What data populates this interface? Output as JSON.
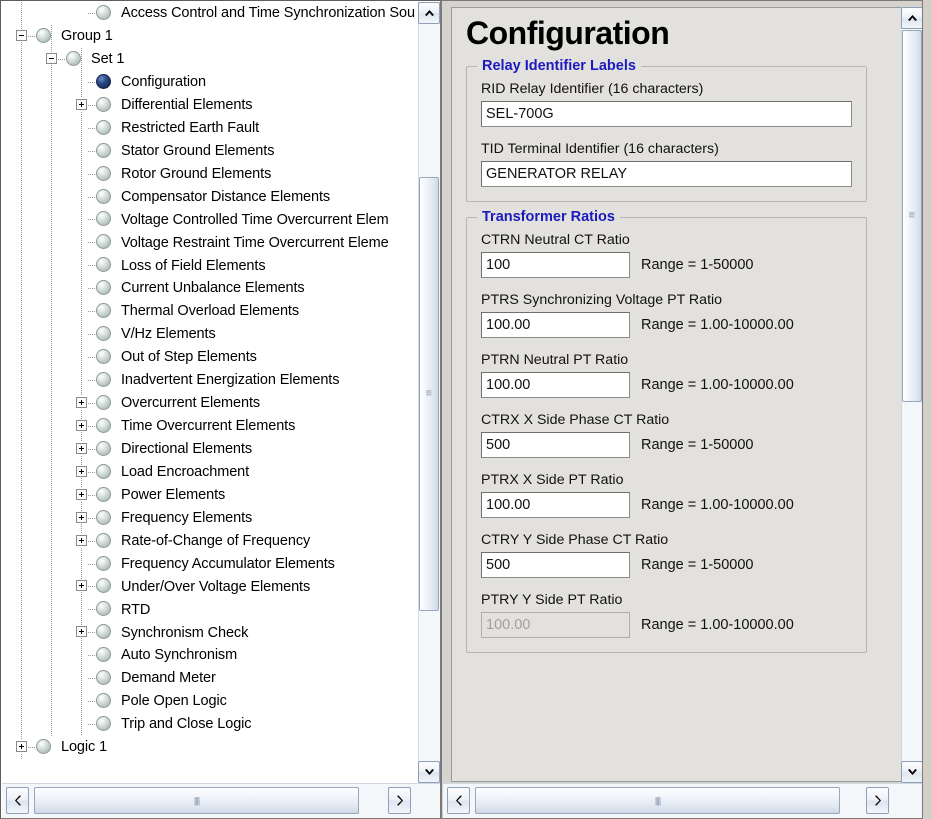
{
  "tree": {
    "nodes": [
      {
        "label": "Access Control and Time Synchronization Sou",
        "depth": 3,
        "expander": "none",
        "selected": false
      },
      {
        "label": "Group 1",
        "depth": 1,
        "expander": "minus",
        "selected": false
      },
      {
        "label": "Set 1",
        "depth": 2,
        "expander": "minus",
        "selected": false
      },
      {
        "label": "Configuration",
        "depth": 3,
        "expander": "none",
        "selected": true
      },
      {
        "label": "Differential Elements",
        "depth": 3,
        "expander": "plus",
        "selected": false
      },
      {
        "label": "Restricted Earth Fault",
        "depth": 3,
        "expander": "none",
        "selected": false
      },
      {
        "label": "Stator Ground Elements",
        "depth": 3,
        "expander": "none",
        "selected": false
      },
      {
        "label": "Rotor Ground Elements",
        "depth": 3,
        "expander": "none",
        "selected": false
      },
      {
        "label": "Compensator Distance Elements",
        "depth": 3,
        "expander": "none",
        "selected": false
      },
      {
        "label": "Voltage Controlled Time Overcurrent Elem",
        "depth": 3,
        "expander": "none",
        "selected": false
      },
      {
        "label": "Voltage Restraint Time Overcurrent Eleme",
        "depth": 3,
        "expander": "none",
        "selected": false
      },
      {
        "label": "Loss of Field Elements",
        "depth": 3,
        "expander": "none",
        "selected": false
      },
      {
        "label": "Current Unbalance Elements",
        "depth": 3,
        "expander": "none",
        "selected": false
      },
      {
        "label": "Thermal Overload  Elements",
        "depth": 3,
        "expander": "none",
        "selected": false
      },
      {
        "label": "V/Hz Elements",
        "depth": 3,
        "expander": "none",
        "selected": false
      },
      {
        "label": "Out of Step Elements",
        "depth": 3,
        "expander": "none",
        "selected": false
      },
      {
        "label": "Inadvertent Energization Elements",
        "depth": 3,
        "expander": "none",
        "selected": false
      },
      {
        "label": "Overcurrent Elements",
        "depth": 3,
        "expander": "plus",
        "selected": false
      },
      {
        "label": "Time Overcurrent Elements",
        "depth": 3,
        "expander": "plus",
        "selected": false
      },
      {
        "label": "Directional Elements",
        "depth": 3,
        "expander": "plus",
        "selected": false
      },
      {
        "label": "Load Encroachment",
        "depth": 3,
        "expander": "plus",
        "selected": false
      },
      {
        "label": "Power Elements",
        "depth": 3,
        "expander": "plus",
        "selected": false
      },
      {
        "label": "Frequency Elements",
        "depth": 3,
        "expander": "plus",
        "selected": false
      },
      {
        "label": "Rate-of-Change of Frequency",
        "depth": 3,
        "expander": "plus",
        "selected": false
      },
      {
        "label": "Frequency Accumulator Elements",
        "depth": 3,
        "expander": "none",
        "selected": false
      },
      {
        "label": "Under/Over Voltage Elements",
        "depth": 3,
        "expander": "plus",
        "selected": false
      },
      {
        "label": "RTD",
        "depth": 3,
        "expander": "none",
        "selected": false
      },
      {
        "label": "Synchronism Check",
        "depth": 3,
        "expander": "plus",
        "selected": false
      },
      {
        "label": "Auto Synchronism",
        "depth": 3,
        "expander": "none",
        "selected": false
      },
      {
        "label": "Demand Meter",
        "depth": 3,
        "expander": "none",
        "selected": false
      },
      {
        "label": "Pole Open Logic",
        "depth": 3,
        "expander": "none",
        "selected": false
      },
      {
        "label": "Trip and Close Logic",
        "depth": 3,
        "expander": "none",
        "selected": false
      },
      {
        "label": "Logic 1",
        "depth": 1,
        "expander": "plus",
        "selected": false
      }
    ],
    "scrollbars": {
      "up_arrow": "▲",
      "down_arrow": "▼",
      "left_arrow": "◀",
      "right_arrow": "▶"
    }
  },
  "config": {
    "title": "Configuration",
    "groups": [
      {
        "title": "Relay Identifier Labels",
        "fields": [
          {
            "label": "RID  Relay Identifier (16 characters)",
            "value": "SEL-700G",
            "range": "",
            "width": "wide",
            "disabled": false
          },
          {
            "label": "TID  Terminal Identifier (16 characters)",
            "value": "GENERATOR RELAY",
            "range": "",
            "width": "wide",
            "disabled": false
          }
        ]
      },
      {
        "title": "Transformer Ratios",
        "fields": [
          {
            "label": "CTRN  Neutral CT Ratio",
            "value": "100",
            "range": "Range = 1-50000",
            "width": "narrow",
            "disabled": false
          },
          {
            "label": "PTRS  Synchronizing Voltage PT Ratio",
            "value": "100.00",
            "range": "Range = 1.00-10000.00",
            "width": "narrow",
            "disabled": false
          },
          {
            "label": "PTRN  Neutral PT Ratio",
            "value": "100.00",
            "range": "Range = 1.00-10000.00",
            "width": "narrow",
            "disabled": false
          },
          {
            "label": "CTRX  X Side Phase CT Ratio",
            "value": "500",
            "range": "Range = 1-50000",
            "width": "narrow",
            "disabled": false
          },
          {
            "label": "PTRX  X Side PT Ratio",
            "value": "100.00",
            "range": "Range = 1.00-10000.00",
            "width": "narrow",
            "disabled": false
          },
          {
            "label": "CTRY  Y Side Phase CT Ratio",
            "value": "500",
            "range": "Range = 1-50000",
            "width": "narrow",
            "disabled": false
          },
          {
            "label": "PTRY  Y Side PT Ratio",
            "value": "100.00",
            "range": "Range = 1.00-10000.00",
            "width": "narrow",
            "disabled": true
          }
        ]
      }
    ]
  },
  "colors": {
    "group_title": "#1b1bbd",
    "panel_bg": "#e3e1de",
    "tree_bg": "#ffffff",
    "selected_node": "#17305e"
  }
}
